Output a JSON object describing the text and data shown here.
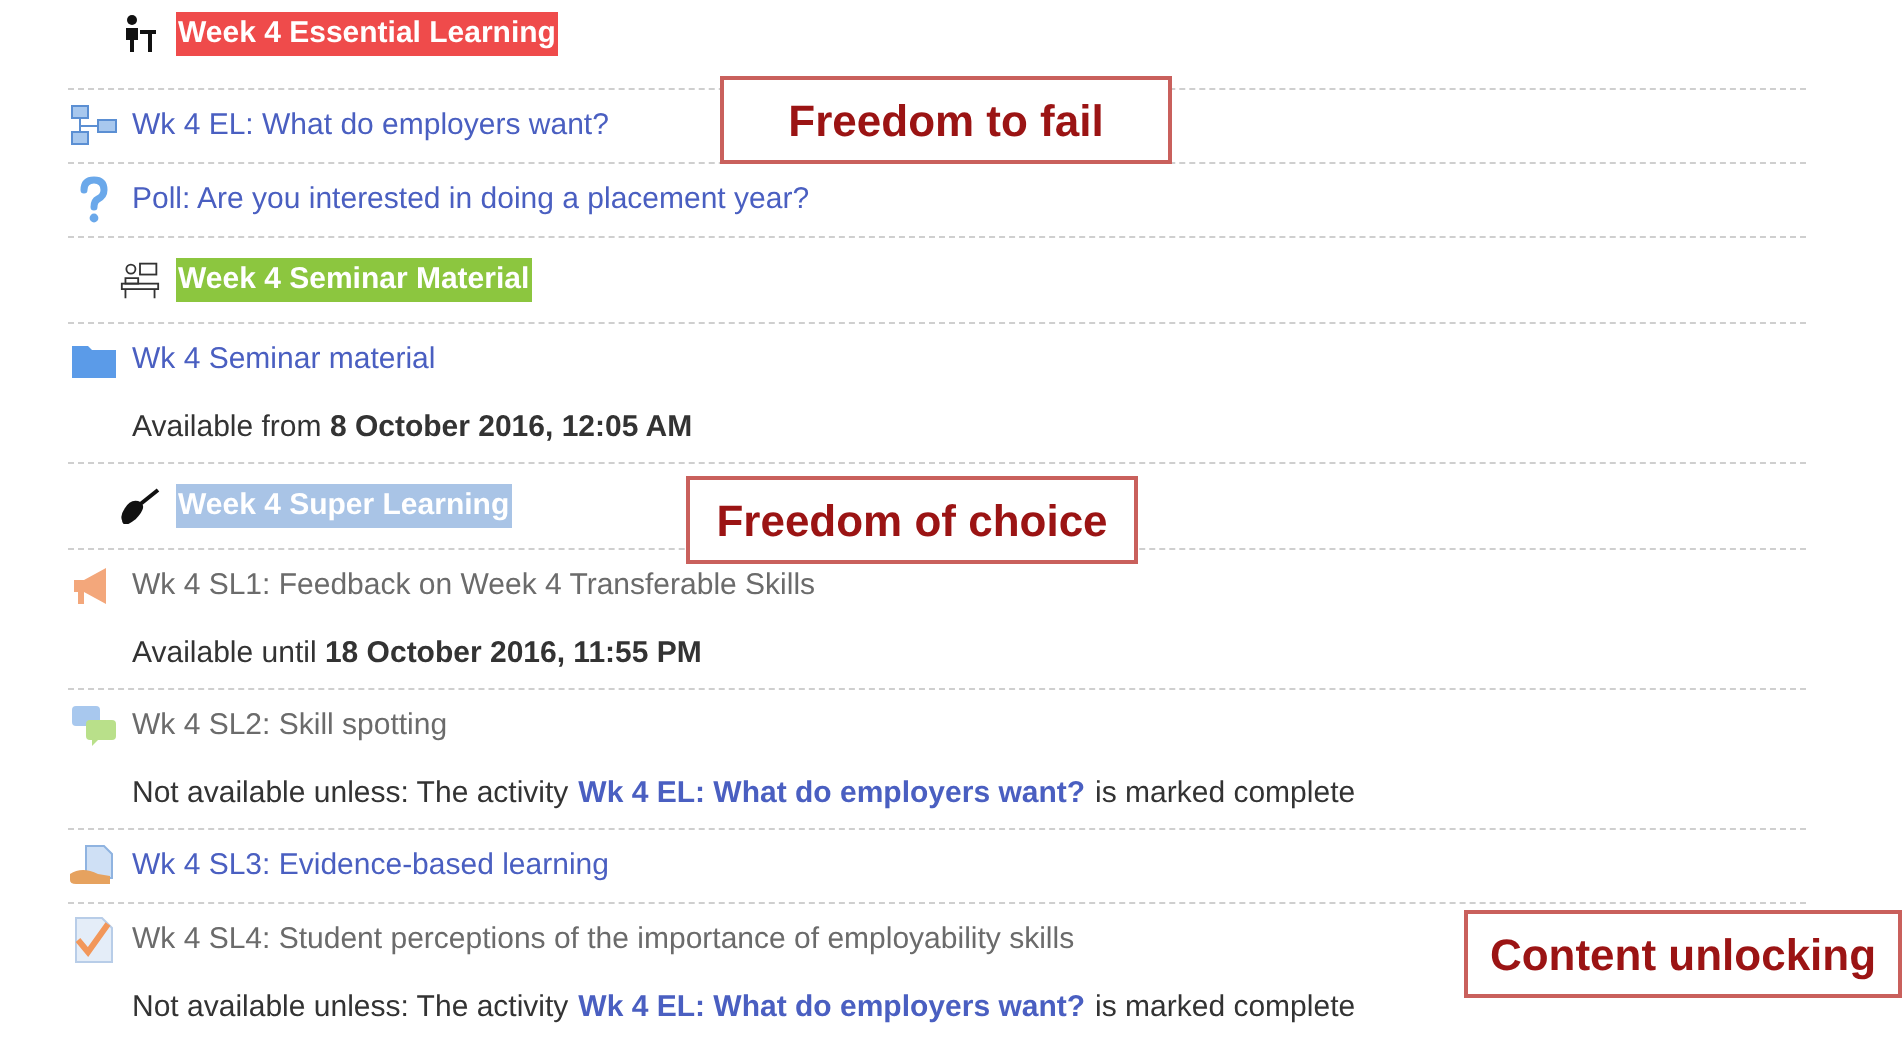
{
  "items": [
    {
      "kind": "label",
      "text": "Week 4 Essential Learning",
      "color": "#ef4b4b"
    },
    {
      "kind": "activity",
      "title": "Wk 4 EL: What do employers want?",
      "dimmed": false
    },
    {
      "kind": "activity",
      "title": "Poll: Are you interested in doing a placement year?",
      "dimmed": false
    },
    {
      "kind": "label",
      "text": "Week 4 Seminar Material",
      "color": "#8cc63f"
    },
    {
      "kind": "activity",
      "title": "Wk 4 Seminar material",
      "dimmed": false,
      "note": {
        "kind": "date",
        "text": "Available from **8 October 2016, 12:05 AM**"
      }
    },
    {
      "kind": "label",
      "text": "Week 4 Super Learning",
      "color": "#a9c4e6"
    },
    {
      "kind": "activity",
      "title": "Wk 4 SL1: Feedback on Week 4 Transferable Skills",
      "dimmed": true,
      "note": {
        "kind": "date",
        "text": "Available until **18 October 2016, 11:55 PM**"
      }
    },
    {
      "kind": "activity",
      "title": "Wk 4 SL2: Skill spotting",
      "dimmed": true,
      "note": {
        "kind": "condition",
        "before": "Not available unless: The activity",
        "link": "Wk 4 EL: What do employers want?",
        "after": "is marked complete"
      }
    },
    {
      "kind": "activity",
      "title": "Wk 4 SL3: Evidence-based learning",
      "dimmed": false
    },
    {
      "kind": "activity",
      "title": "Wk 4 SL4: Student perceptions of the importance of employability skills",
      "dimmed": true,
      "note": {
        "kind": "condition",
        "before": "Not available unless: The activity",
        "link": "Wk 4 EL: What do employers want?",
        "after": "is marked complete"
      }
    }
  ],
  "callouts": [
    "Freedom to fail",
    "Freedom of choice",
    "Content unlocking"
  ]
}
